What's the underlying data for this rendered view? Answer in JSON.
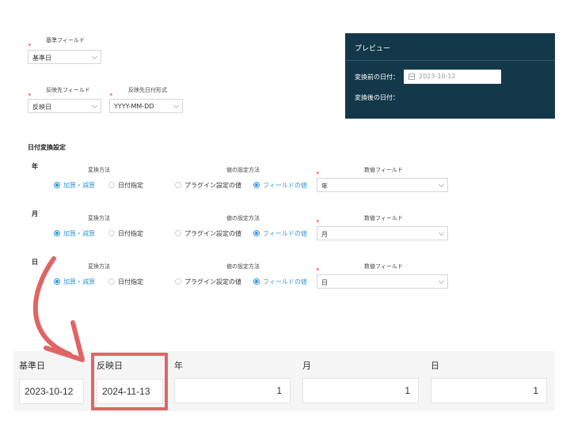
{
  "base_field": {
    "label": "基準フィールド",
    "value": "基準日"
  },
  "reflect_field": {
    "label": "反映先フィールド",
    "value": "反映日"
  },
  "date_format": {
    "label": "反映先日付形式",
    "value": "YYYY-MM-DD"
  },
  "preview": {
    "title": "プレビュー",
    "before_label": "変換前の日付：",
    "before_value": "2023-10-12",
    "after_label": "変換後の日付："
  },
  "conversion": {
    "title": "日付変換設定",
    "method_label": "変換方法",
    "value_method_label": "値の設定方法",
    "number_field_label": "数値フィールド",
    "opt_add_sub": "加算・減算",
    "opt_specify": "日付指定",
    "opt_plugin": "プラグイン設定の値",
    "opt_field": "フィールドの値",
    "rows": [
      {
        "unit": "年",
        "field": "年"
      },
      {
        "unit": "月",
        "field": "月"
      },
      {
        "unit": "日",
        "field": "日"
      }
    ]
  },
  "record": {
    "columns": [
      {
        "label": "基準日",
        "value": "2023-10-12"
      },
      {
        "label": "反映日",
        "value": "2024-11-13"
      },
      {
        "label": "年",
        "value": "1"
      },
      {
        "label": "月",
        "value": "1"
      },
      {
        "label": "日",
        "value": "1"
      }
    ]
  },
  "colors": {
    "preview_bg": "#13384a",
    "accent": "#3498db",
    "highlight": "#df6565",
    "required": "#e74c3c"
  }
}
